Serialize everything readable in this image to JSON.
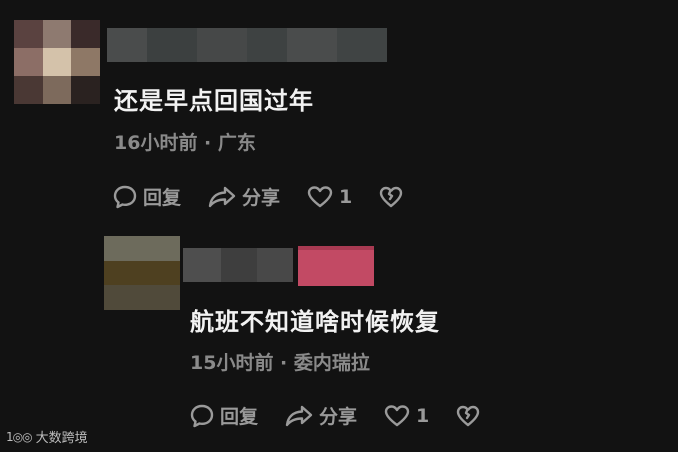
{
  "comments": [
    {
      "text": "还是早点回国过年",
      "meta": "16小时前 · 广东",
      "reply_label": "回复",
      "share_label": "分享",
      "like_count": "1"
    },
    {
      "text": "航班不知道啥时候恢复",
      "meta": "15小时前 · 委内瑞拉",
      "reply_label": "回复",
      "share_label": "分享",
      "like_count": "1"
    }
  ],
  "watermark": {
    "logo": "1◎◎",
    "text": "大数跨境"
  },
  "colors": {
    "background": "#121212",
    "text": "#f2f2f2",
    "secondary": "#8a8a8a",
    "icon": "#9a9a9a"
  },
  "icons": [
    "comment-bubble-icon",
    "share-arrow-icon",
    "heart-icon",
    "broken-heart-icon"
  ]
}
